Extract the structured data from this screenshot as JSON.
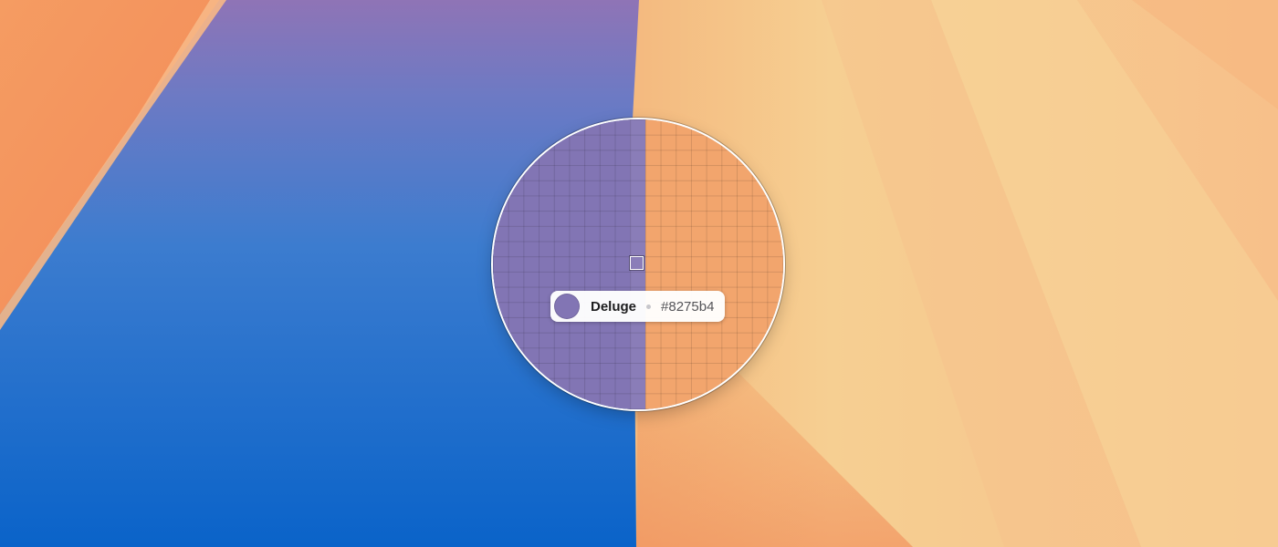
{
  "colors": {
    "sampled_color": "#8275b4",
    "left_side": "#8275b4",
    "right_side": "#f2a56d",
    "wallpaper_blue": "#0b6fcd",
    "wallpaper_orange": "#f4a168"
  },
  "color_picker": {
    "color_name": "Deluge",
    "hex_value": "#8275b4",
    "icons": {
      "swatch": "color-swatch-icon",
      "separator": "dot-separator-icon",
      "reticle": "pixel-reticle-icon"
    }
  }
}
